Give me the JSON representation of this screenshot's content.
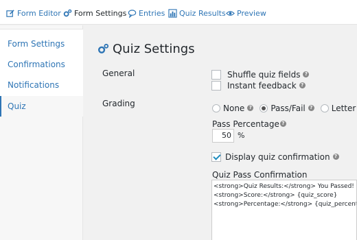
{
  "toolbar": {
    "items": [
      {
        "label": "Form Editor",
        "icon": "edit-icon"
      },
      {
        "label": "Form Settings",
        "icon": "gears-icon"
      },
      {
        "label": "Entries",
        "icon": "comment-icon"
      },
      {
        "label": "Quiz Results",
        "icon": "bar-chart-icon"
      },
      {
        "label": "Preview",
        "icon": "eye-icon"
      }
    ]
  },
  "sidebar": {
    "items": [
      {
        "label": "Form Settings"
      },
      {
        "label": "Confirmations"
      },
      {
        "label": "Notifications"
      },
      {
        "label": "Quiz"
      }
    ]
  },
  "main": {
    "title": "Quiz Settings",
    "general": {
      "label": "General",
      "shuffle_label": "Shuffle quiz fields",
      "shuffle_checked": false,
      "instant_label": "Instant feedback",
      "instant_checked": false
    },
    "grading": {
      "label": "Grading",
      "options": [
        {
          "label": "None",
          "checked": false
        },
        {
          "label": "Pass/Fail",
          "checked": true
        },
        {
          "label": "Letter",
          "checked": false
        }
      ],
      "pass_percentage_label": "Pass Percentage",
      "pass_percentage_value": "50",
      "percent_sign": "%",
      "display_confirmation_label": "Display quiz confirmation",
      "display_confirmation_checked": true,
      "pass_confirmation_label": "Quiz Pass Confirmation",
      "pass_confirmation_text": "<strong>Quiz Results:</strong> You Passed!\n<strong>Score:</strong> {quiz_score}\n<strong>Percentage:</strong> {quiz_percent}%"
    }
  },
  "colors": {
    "link": "#2e75b5",
    "background": "#f1f1f1"
  }
}
